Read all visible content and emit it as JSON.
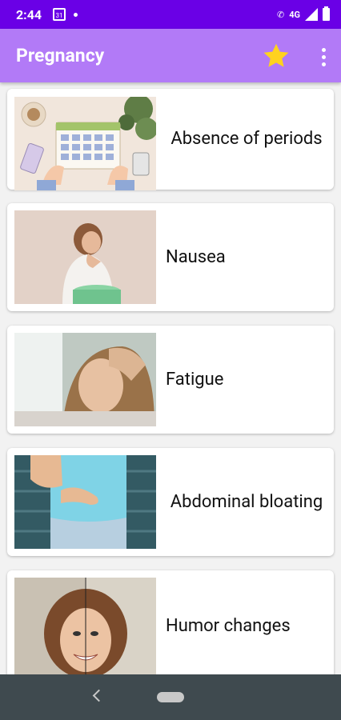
{
  "status": {
    "time": "2:44",
    "calendar_day": "31",
    "network": "4G"
  },
  "appbar": {
    "title": "Pregnancy",
    "favorite_icon": "star-icon",
    "menu_icon": "more-vert-icon"
  },
  "items": [
    {
      "label": "Absence of periods",
      "image": "calendar-illustration"
    },
    {
      "label": "Nausea",
      "image": "woman-nausea-photo"
    },
    {
      "label": "Fatigue",
      "image": "tired-woman-photo"
    },
    {
      "label": "Abdominal bloating",
      "image": "bloated-belly-photo"
    },
    {
      "label": "Humor changes",
      "image": "mood-split-face-photo"
    }
  ],
  "colors": {
    "statusbar": "#6a00e6",
    "appbar": "#b27af7",
    "star": "#ffd21f",
    "navbar": "#3f4a4f"
  }
}
